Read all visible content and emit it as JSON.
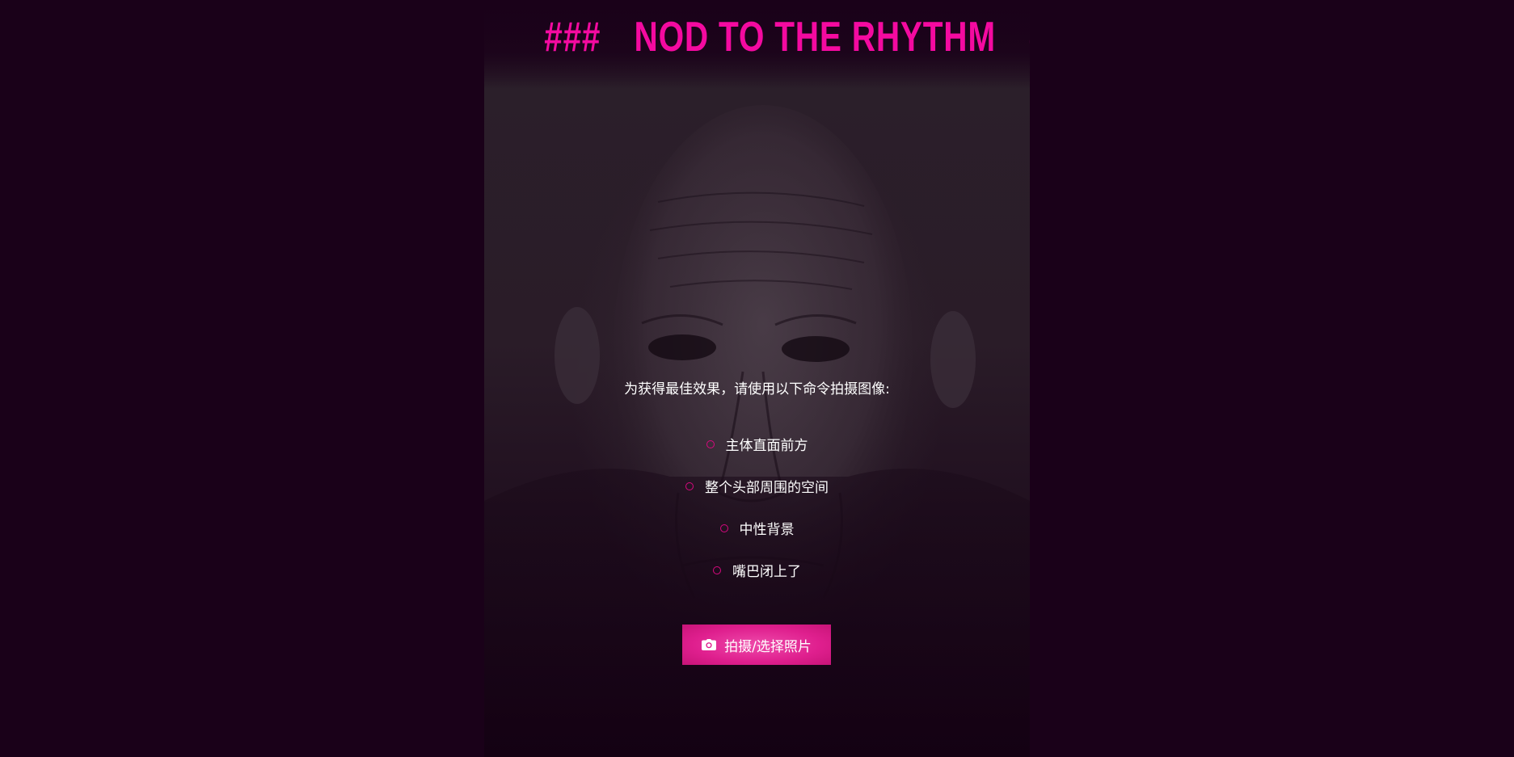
{
  "header": {
    "left_mark": "###",
    "title": "NOD TO THE RHYTHM",
    "right_mark": "###"
  },
  "instructions": {
    "intro": "为获得最佳效果，请使用以下命令拍摄图像:",
    "items": [
      {
        "label": "主体直面前方"
      },
      {
        "label": "整个头部周围的空间"
      },
      {
        "label": "中性背景"
      },
      {
        "label": "嘴巴闭上了"
      }
    ]
  },
  "action": {
    "button_label": "拍摄/选择照片",
    "button_icon": "camera-icon"
  },
  "colors": {
    "page_background": "#1a0119",
    "accent": "#f40aa0",
    "button": "#df1f8e",
    "text": "#ffffff"
  }
}
